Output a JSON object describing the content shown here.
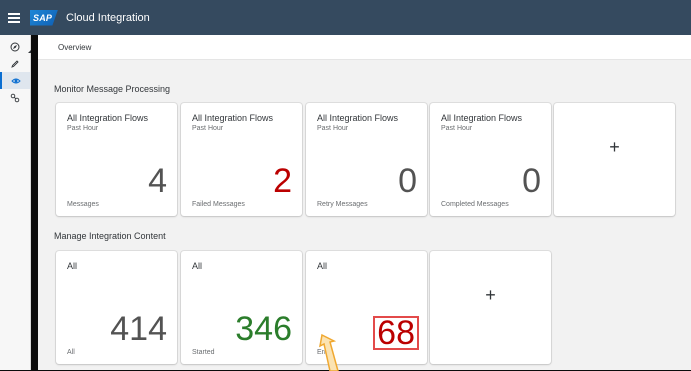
{
  "shell": {
    "logo": "SAP",
    "app_title": "Cloud Integration"
  },
  "breadcrumb": "Overview",
  "sidenav": {
    "items": [
      {
        "icon": "discover-icon",
        "active": false
      },
      {
        "icon": "pencil-icon",
        "active": false
      },
      {
        "icon": "eye-icon",
        "active": true
      },
      {
        "icon": "settings-connector-icon",
        "active": false
      }
    ]
  },
  "monitor": {
    "title": "Monitor Message Processing",
    "tiles": [
      {
        "header": "All Integration Flows",
        "sub": "Past Hour",
        "value": "4",
        "footer": "Messages"
      },
      {
        "header": "All Integration Flows",
        "sub": "Past Hour",
        "value": "2",
        "footer": "Failed Messages"
      },
      {
        "header": "All Integration Flows",
        "sub": "Past Hour",
        "value": "0",
        "footer": "Retry Messages"
      },
      {
        "header": "All Integration Flows",
        "sub": "Past Hour",
        "value": "0",
        "footer": "Completed Messages"
      }
    ],
    "add_label": "+"
  },
  "manage": {
    "title": "Manage Integration Content",
    "tiles": [
      {
        "header": "All",
        "value": "414",
        "footer": "All"
      },
      {
        "header": "All",
        "value": "346",
        "footer": "Started"
      },
      {
        "header": "All",
        "value": "68",
        "footer": "Error"
      }
    ],
    "add_label": "+"
  },
  "colors": {
    "shell_bg": "#354a5f",
    "accent": "#0a6ed1",
    "error": "#bb0000",
    "success": "#2b7d2b",
    "highlight_box": "#e34a4a",
    "callout_arrow": "#f0a830"
  }
}
